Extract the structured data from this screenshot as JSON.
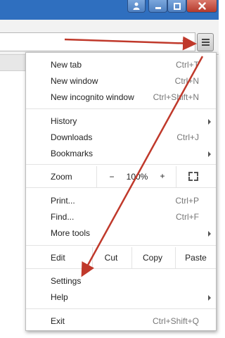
{
  "menu": {
    "group1": [
      {
        "label": "New tab",
        "shortcut": "Ctrl+T"
      },
      {
        "label": "New window",
        "shortcut": "Ctrl+N"
      },
      {
        "label": "New incognito window",
        "shortcut": "Ctrl+Shift+N"
      }
    ],
    "group2": [
      {
        "label": "History",
        "submenu": true
      },
      {
        "label": "Downloads",
        "shortcut": "Ctrl+J"
      },
      {
        "label": "Bookmarks",
        "submenu": true
      }
    ],
    "zoom": {
      "label": "Zoom",
      "minus": "−",
      "value": "100%",
      "plus": "+"
    },
    "group3": [
      {
        "label": "Print...",
        "shortcut": "Ctrl+P"
      },
      {
        "label": "Find...",
        "shortcut": "Ctrl+F"
      },
      {
        "label": "More tools",
        "submenu": true
      }
    ],
    "edit": {
      "label": "Edit",
      "cut": "Cut",
      "copy": "Copy",
      "paste": "Paste"
    },
    "group4": [
      {
        "label": "Settings"
      },
      {
        "label": "Help",
        "submenu": true
      }
    ],
    "exit": {
      "label": "Exit",
      "shortcut": "Ctrl+Shift+Q"
    }
  },
  "icons": {
    "profile": "person-icon",
    "minimize": "minimize-icon",
    "maximize": "maximize-icon",
    "close": "close-icon",
    "bookmark": "star-icon",
    "menu": "hamburger-menu-icon",
    "fullscreen": "fullscreen-icon"
  },
  "colors": {
    "annotation_arrow": "#c0392b",
    "title_bar": "#2f6fbf",
    "close_button": "#c94a3b"
  }
}
